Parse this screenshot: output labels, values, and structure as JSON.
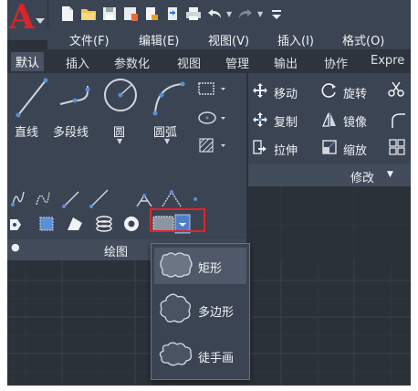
{
  "menu": [
    "文件(F)",
    "编辑(E)",
    "视图(V)",
    "插入(I)",
    "格式(O)"
  ],
  "tabs": [
    "默认",
    "插入",
    "参数化",
    "视图",
    "管理",
    "输出",
    "协作",
    "Expre"
  ],
  "draw_tools": {
    "line": "直线",
    "polyline": "多段线",
    "circle": "圆",
    "arc": "圆弧"
  },
  "modify_tools": {
    "move": "移动",
    "rotate": "旋转",
    "copy": "复制",
    "mirror": "镜像",
    "stretch": "拉伸",
    "scale": "缩放"
  },
  "panels": {
    "draw": "绘图",
    "modify": "修改"
  },
  "dropdown": [
    "矩形",
    "多边形",
    "徒手画"
  ],
  "colors": {
    "highlight_border": "#e0242a",
    "ribbon_bg": "#3b4453",
    "canvas_bg": "#2b3138",
    "accent_blue": "#5a8fd6"
  }
}
